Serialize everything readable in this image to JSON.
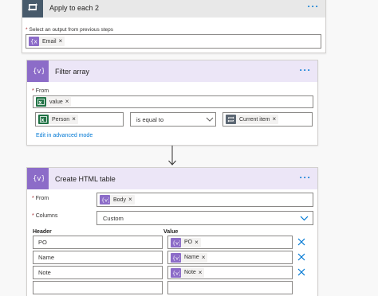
{
  "loop": {
    "title": "Apply to each 2",
    "select_label": "Select an output from previous steps",
    "token": {
      "label": "Email",
      "icon": "expression-icon"
    }
  },
  "filter": {
    "title": "Filter array",
    "from_label": "From",
    "from_token": {
      "label": "value",
      "icon": "excel-icon"
    },
    "condition_left": {
      "label": "Person",
      "icon": "excel-icon"
    },
    "operator": "is equal to",
    "condition_right": {
      "label": "Current item",
      "icon": "loop-icon"
    },
    "advanced_link": "Edit in advanced mode"
  },
  "html_table": {
    "title": "Create HTML table",
    "from_label": "From",
    "from_token": {
      "label": "Body",
      "icon": "variable-icon"
    },
    "columns_label": "Columns",
    "columns_value": "Custom",
    "header_col": "Header",
    "value_col": "Value",
    "rows": [
      {
        "header": "PO",
        "value": "PO"
      },
      {
        "header": "Name",
        "value": "Name"
      },
      {
        "header": "Note",
        "value": "Note"
      },
      {
        "header": "",
        "value": ""
      }
    ]
  },
  "colors": {
    "loop_header": "#e8e8e8",
    "loop_icon": "#475a6b",
    "filter_header": "#ece6f7",
    "filter_icon": "#8c6cc8",
    "accent": "#0078d4",
    "excel": "#217346",
    "remove_x": "#0078d4"
  }
}
